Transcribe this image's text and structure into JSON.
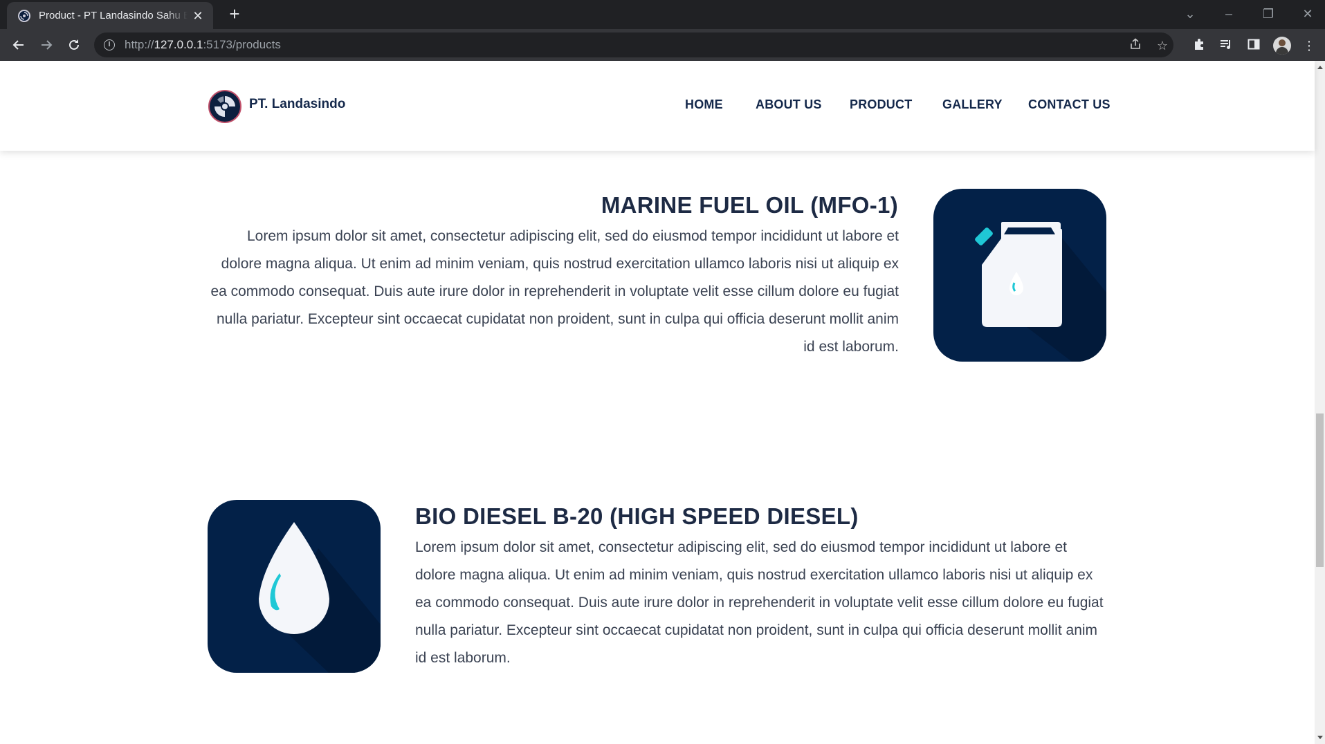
{
  "browser": {
    "tab_title": "Product - PT Landasindo Sahu Bahari",
    "tab_close": "✕",
    "new_tab": "+",
    "url_prefix": "http://",
    "url_host": "127.0.0.1",
    "url_path": ":5173/products"
  },
  "site": {
    "brand": "PT. Landasindo",
    "nav": [
      "HOME",
      "ABOUT US",
      "PRODUCT",
      "GALLERY",
      "CONTACT US"
    ]
  },
  "products": [
    {
      "title": "MARINE FUEL OIL (MFO-1)",
      "description": "Lorem ipsum dolor sit amet, consectetur adipiscing elit, sed do eiusmod tempor incididunt ut labore et dolore magna aliqua. Ut enim ad minim veniam, quis nostrud exercitation ullamco laboris nisi ut aliquip ex ea commodo consequat. Duis aute irure dolor in reprehenderit in voluptate velit esse cillum dolore eu fugiat nulla pariatur. Excepteur sint occaecat cupidatat non proident, sunt in culpa qui officia deserunt mollit anim id est laborum.",
      "icon": "fuel-jerrycan-icon"
    },
    {
      "title": "BIO DIESEL B-20 (HIGH SPEED DIESEL)",
      "description": "Lorem ipsum dolor sit amet, consectetur adipiscing elit, sed do eiusmod tempor incididunt ut labore et dolore magna aliqua. Ut enim ad minim veniam, quis nostrud exercitation ullamco laboris nisi ut aliquip ex ea commodo consequat. Duis aute irure dolor in reprehenderit in voluptate velit esse cillum dolore eu fugiat nulla pariatur. Excepteur sint occaecat cupidatat non proident, sunt in culpa qui officia deserunt mollit anim id est laborum.",
      "icon": "oil-drop-icon"
    }
  ],
  "colors": {
    "brand_navy": "#032148",
    "accent_cyan": "#1fc8d6",
    "text_dark": "#1d2a44"
  }
}
